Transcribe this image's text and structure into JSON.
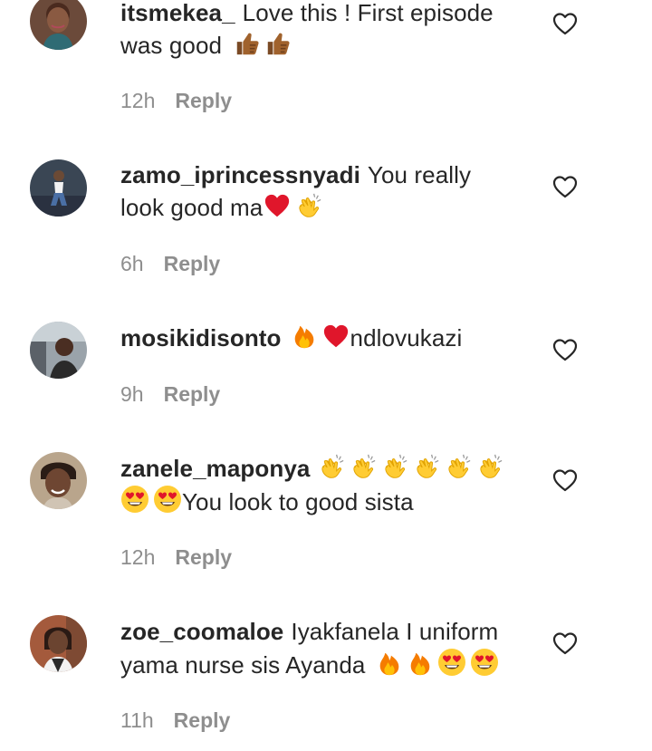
{
  "comments": [
    {
      "username": "itsmekea_",
      "text_line1": "Love this ! First episode",
      "text_line2": "was good",
      "emojis": [
        "thumbs-up-icon",
        "thumbs-up-icon"
      ],
      "time": "12h",
      "reply_label": "Reply",
      "like_icon": "heart-outline-icon"
    },
    {
      "username": "zamo_iprincessnyadi",
      "text_line1": "You really",
      "text_line2": "look good ma",
      "emojis": [
        "red-heart-icon",
        "clapping-hands-icon"
      ],
      "time": "6h",
      "reply_label": "Reply",
      "like_icon": "heart-outline-icon"
    },
    {
      "username": "mosikidisonto",
      "text_line1": "ndlovukazi",
      "emojis": [
        "fire-icon",
        "red-heart-icon"
      ],
      "time": "9h",
      "reply_label": "Reply",
      "like_icon": "heart-outline-icon"
    },
    {
      "username": "zanele_maponya",
      "text_line2": "You look to good sista",
      "emojis": [
        "clapping-hands-icon",
        "clapping-hands-icon",
        "clapping-hands-icon",
        "clapping-hands-icon",
        "clapping-hands-icon",
        "clapping-hands-icon",
        "heart-eyes-face-icon",
        "heart-eyes-face-icon"
      ],
      "time": "12h",
      "reply_label": "Reply",
      "like_icon": "heart-outline-icon"
    },
    {
      "username": "zoe_coomaloe",
      "text_line1": "Iyakfanela I uniform",
      "text_line2": "yama nurse sis Ayanda",
      "emojis": [
        "fire-icon",
        "fire-icon",
        "heart-eyes-face-icon",
        "heart-eyes-face-icon"
      ],
      "time": "11h",
      "reply_label": "Reply",
      "like_icon": "heart-outline-icon"
    }
  ],
  "colors": {
    "text": "#262626",
    "secondary": "#8e8e8e",
    "heart_red": "#e0162b",
    "emoji_yellow": "#ffcc33",
    "fire_orange": "#f57c00"
  }
}
